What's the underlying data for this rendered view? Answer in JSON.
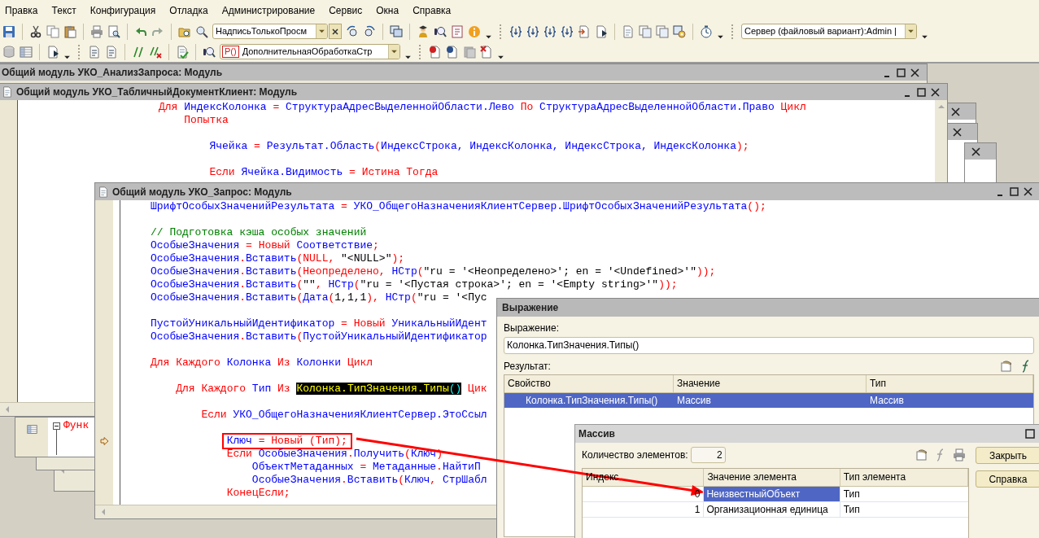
{
  "menu": [
    "Правка",
    "Текст",
    "Конфигурация",
    "Отладка",
    "Администрирование",
    "Сервис",
    "Окна",
    "Справка"
  ],
  "toolbar": {
    "find_combo": {
      "value": "НадписьТолькоПросм"
    },
    "processing_combo": {
      "badge": "P()",
      "value": "ДополнительнаяОбработкаСтр"
    },
    "server_combo": {
      "value": "Сервер (файловый вариант):Admin |"
    }
  },
  "windows": [
    {
      "title": "Общий модуль УКО_АнализЗапроса: Модуль"
    },
    {
      "title": "Общий модуль УКО_ТабличныйДокументКлиент: Модуль",
      "lines": [
        {
          "kind": "code",
          "segments": [
            {
              "kind": "keyword",
              "text": "Для"
            },
            {
              "kind": "name",
              "text": " ИндексКолонка "
            },
            {
              "kind": "operator",
              "text": "="
            },
            {
              "kind": "name",
              "text": " СтруктураАдресВыделеннойОбласти.Лево "
            },
            {
              "kind": "keyword",
              "text": "По"
            },
            {
              "kind": "name",
              "text": " СтруктураАдресВыделеннойОбласти.Право "
            },
            {
              "kind": "keyword",
              "text": "Цикл"
            }
          ]
        },
        {
          "kind": "code",
          "segments": [
            {
              "kind": "keyword",
              "text": "    Попытка"
            }
          ]
        },
        {
          "kind": "blank"
        },
        {
          "kind": "code",
          "segments": [
            {
              "kind": "name",
              "text": "        Ячейка "
            },
            {
              "kind": "operator",
              "text": "="
            },
            {
              "kind": "name",
              "text": " Результат.Область"
            },
            {
              "kind": "operator",
              "text": "("
            },
            {
              "kind": "name",
              "text": "ИндексСтрока, ИндексКолонка, ИндексСтрока, ИндексКолонка"
            },
            {
              "kind": "operator",
              "text": ");"
            }
          ]
        },
        {
          "kind": "blank"
        },
        {
          "kind": "code",
          "segments": [
            {
              "kind": "keyword",
              "text": "        Если"
            },
            {
              "kind": "name",
              "text": " Ячейка.Видимость "
            },
            {
              "kind": "operator",
              "text": "="
            },
            {
              "kind": "keyword",
              "text": " Истина Тогда"
            }
          ]
        }
      ]
    },
    {
      "title": "Общий модуль УКО_Запрос: Модуль",
      "lines": [
        {
          "kind": "code",
          "current": false,
          "segments": [
            {
              "kind": "name",
              "text": "ШрифтОсобыхЗначенийРезультата "
            },
            {
              "kind": "operator",
              "text": "="
            },
            {
              "kind": "name",
              "text": " УКО_ОбщегоНазначенияКлиентСервер.ШрифтОсобыхЗначенийРезультата"
            },
            {
              "kind": "operator",
              "text": "();"
            }
          ]
        },
        {
          "kind": "blank",
          "current": false
        },
        {
          "kind": "code",
          "current": false,
          "segments": [
            {
              "kind": "comment",
              "text": "// Подготовка кэша особых значений"
            }
          ]
        },
        {
          "kind": "code",
          "current": false,
          "segments": [
            {
              "kind": "name",
              "text": "ОсобыеЗначения "
            },
            {
              "kind": "operator",
              "text": "="
            },
            {
              "kind": "keyword",
              "text": " Новый"
            },
            {
              "kind": "name",
              "text": " Соответствие"
            },
            {
              "kind": "operator",
              "text": ";"
            }
          ]
        },
        {
          "kind": "code",
          "current": false,
          "segments": [
            {
              "kind": "name",
              "text": "ОсобыеЗначения"
            },
            {
              "kind": "operator",
              "text": "."
            },
            {
              "kind": "name",
              "text": "Вставить"
            },
            {
              "kind": "operator",
              "text": "(NULL, "
            },
            {
              "kind": "string",
              "text": "\"<NULL>\""
            },
            {
              "kind": "operator",
              "text": ");"
            }
          ]
        },
        {
          "kind": "code",
          "current": false,
          "segments": [
            {
              "kind": "name",
              "text": "ОсобыеЗначения"
            },
            {
              "kind": "operator",
              "text": "."
            },
            {
              "kind": "name",
              "text": "Вставить"
            },
            {
              "kind": "operator",
              "text": "(Неопределено, "
            },
            {
              "kind": "name",
              "text": "НСтр"
            },
            {
              "kind": "operator",
              "text": "("
            },
            {
              "kind": "string",
              "text": "\"ru = '<Неопределено>'; en = '<Undefined>'\""
            },
            {
              "kind": "operator",
              "text": "));"
            }
          ]
        },
        {
          "kind": "code",
          "current": false,
          "segments": [
            {
              "kind": "name",
              "text": "ОсобыеЗначения"
            },
            {
              "kind": "operator",
              "text": "."
            },
            {
              "kind": "name",
              "text": "Вставить"
            },
            {
              "kind": "operator",
              "text": "("
            },
            {
              "kind": "string",
              "text": "\"\""
            },
            {
              "kind": "operator",
              "text": ", "
            },
            {
              "kind": "name",
              "text": "НСтр"
            },
            {
              "kind": "operator",
              "text": "("
            },
            {
              "kind": "string",
              "text": "\"ru = '<Пустая строка>'; en = '<Empty string>'\""
            },
            {
              "kind": "operator",
              "text": "));"
            }
          ]
        },
        {
          "kind": "code",
          "current": false,
          "segments": [
            {
              "kind": "name",
              "text": "ОсобыеЗначения"
            },
            {
              "kind": "operator",
              "text": "."
            },
            {
              "kind": "name",
              "text": "Вставить"
            },
            {
              "kind": "operator",
              "text": "("
            },
            {
              "kind": "name",
              "text": "Дата"
            },
            {
              "kind": "operator",
              "text": "("
            },
            {
              "kind": "string",
              "text": "1,1,1"
            },
            {
              "kind": "operator",
              "text": "), "
            },
            {
              "kind": "name",
              "text": "НСтр"
            },
            {
              "kind": "operator",
              "text": "("
            },
            {
              "kind": "string",
              "text": "\"ru = '<Пус"
            }
          ]
        },
        {
          "kind": "blank",
          "current": false
        },
        {
          "kind": "code",
          "current": false,
          "segments": [
            {
              "kind": "name",
              "text": "ПустойУникальныйИдентификатор "
            },
            {
              "kind": "operator",
              "text": "="
            },
            {
              "kind": "keyword",
              "text": " Новый"
            },
            {
              "kind": "name",
              "text": " УникальныйИдент"
            }
          ]
        },
        {
          "kind": "code",
          "current": false,
          "segments": [
            {
              "kind": "name",
              "text": "ОсобыеЗначения"
            },
            {
              "kind": "operator",
              "text": "."
            },
            {
              "kind": "name",
              "text": "Вставить"
            },
            {
              "kind": "operator",
              "text": "("
            },
            {
              "kind": "name",
              "text": "ПустойУникальныйИдентификатор"
            }
          ]
        },
        {
          "kind": "blank",
          "current": false
        },
        {
          "kind": "code",
          "current": false,
          "segments": [
            {
              "kind": "keyword",
              "text": "Для Каждого"
            },
            {
              "kind": "name",
              "text": " Колонка "
            },
            {
              "kind": "keyword",
              "text": "Из"
            },
            {
              "kind": "name",
              "text": " Колонки "
            },
            {
              "kind": "keyword",
              "text": "Цикл"
            }
          ]
        },
        {
          "kind": "blank",
          "current": false
        },
        {
          "kind": "code",
          "current": false,
          "segments": [
            {
              "kind": "keyword",
              "text": "    Для Каждого"
            },
            {
              "kind": "name",
              "text": " Тип "
            },
            {
              "kind": "keyword",
              "text": "Из "
            },
            {
              "kind": "highlight",
              "text": "Колонка.ТипЗначения.Типы"
            },
            {
              "kind": "highlight_paren",
              "text": "()"
            },
            {
              "kind": "keyword",
              "text": " Цик"
            }
          ]
        },
        {
          "kind": "blank",
          "current": false
        },
        {
          "kind": "code",
          "current": false,
          "segments": [
            {
              "kind": "keyword",
              "text": "        Если"
            },
            {
              "kind": "name",
              "text": " УКО_ОбщегоНазначенияКлиентСервер.ЭтоСсыл"
            }
          ]
        },
        {
          "kind": "blank",
          "current": false
        },
        {
          "kind": "code",
          "current": true,
          "segments": [
            {
              "kind": "name",
              "text": "            Ключ "
            },
            {
              "kind": "operator",
              "text": "="
            },
            {
              "kind": "keyword",
              "text": " Новый"
            },
            {
              "kind": "operator",
              "text": " (Тип);"
            }
          ]
        },
        {
          "kind": "code",
          "current": false,
          "segments": [
            {
              "kind": "keyword",
              "text": "            Если"
            },
            {
              "kind": "name",
              "text": " ОсобыеЗначения"
            },
            {
              "kind": "operator",
              "text": "."
            },
            {
              "kind": "name",
              "text": "Получить"
            },
            {
              "kind": "operator",
              "text": "("
            },
            {
              "kind": "name",
              "text": "Ключ"
            },
            {
              "kind": "operator",
              "text": ")"
            }
          ]
        },
        {
          "kind": "code",
          "current": false,
          "segments": [
            {
              "kind": "name",
              "text": "                ОбъектМетаданных "
            },
            {
              "kind": "operator",
              "text": "="
            },
            {
              "kind": "name",
              "text": " Метаданные"
            },
            {
              "kind": "operator",
              "text": "."
            },
            {
              "kind": "name",
              "text": "НайтиП"
            }
          ]
        },
        {
          "kind": "code",
          "current": false,
          "segments": [
            {
              "kind": "name",
              "text": "                ОсобыеЗначения"
            },
            {
              "kind": "operator",
              "text": "."
            },
            {
              "kind": "name",
              "text": "Вставить"
            },
            {
              "kind": "operator",
              "text": "("
            },
            {
              "kind": "name",
              "text": "Ключ"
            },
            {
              "kind": "operator",
              "text": ", "
            },
            {
              "kind": "name",
              "text": "СтрШабл"
            }
          ]
        },
        {
          "kind": "code",
          "current": false,
          "segments": [
            {
              "kind": "keyword",
              "text": "            КонецЕсли"
            },
            {
              "kind": "operator",
              "text": ";"
            }
          ]
        }
      ]
    }
  ],
  "background_fragment": {
    "text": "Функ"
  },
  "expression_dialog": {
    "title": "Выражение",
    "expression_label": "Выражение:",
    "expression": "Колонка.ТипЗначения.Типы()",
    "result_label": "Результат:",
    "columns": [
      "Свойство",
      "Значение",
      "Тип"
    ],
    "rows": [
      {
        "property": "Колонка.ТипЗначения.Типы()",
        "value": "Массив",
        "type": "Массив",
        "selected": true
      }
    ]
  },
  "array_dialog": {
    "title": "Массив",
    "count_label": "Количество элементов:",
    "count": "2",
    "buttons": [
      "Закрыть",
      "Справка"
    ],
    "columns": [
      "Индекс",
      "Значение элемента",
      "Тип элемента"
    ],
    "rows": [
      {
        "index": "0",
        "value": "НеизвестныйОбъект",
        "type": "Тип",
        "selected": true
      },
      {
        "index": "1",
        "value": "Организационная единица",
        "type": "Тип",
        "selected": false
      }
    ]
  }
}
